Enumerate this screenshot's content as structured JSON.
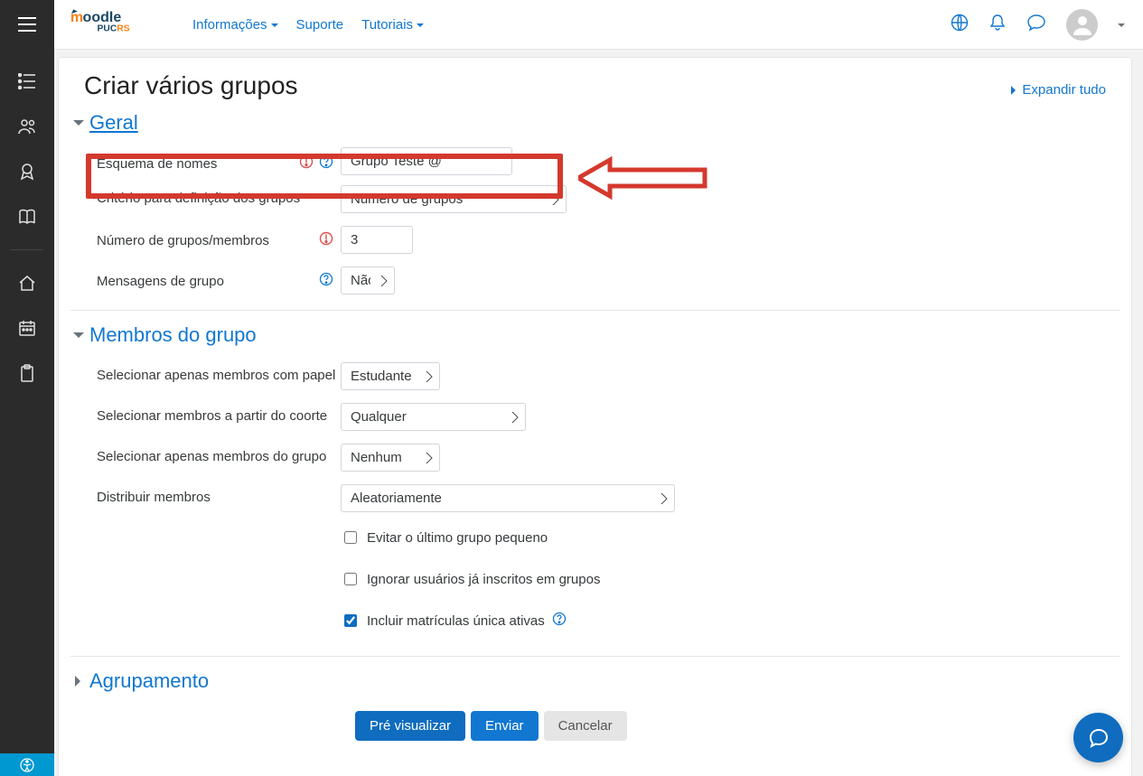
{
  "header": {
    "nav": [
      {
        "label": "Informações",
        "has_caret": true
      },
      {
        "label": "Suporte",
        "has_caret": false
      },
      {
        "label": "Tutoriais",
        "has_caret": true
      }
    ]
  },
  "page": {
    "title": "Criar vários grupos",
    "expand_all": "Expandir tudo"
  },
  "sections": {
    "geral": {
      "title": "Geral",
      "fields": {
        "naming_scheme": {
          "label": "Esquema de nomes",
          "value": "Grupo Teste @"
        },
        "criterion": {
          "label": "Critério para definição dos grupos",
          "value": "Número de grupos"
        },
        "count": {
          "label": "Número de grupos/membros",
          "value": "3"
        },
        "messages": {
          "label": "Mensagens de grupo",
          "value": "Não"
        }
      }
    },
    "membros": {
      "title": "Membros do grupo",
      "fields": {
        "role": {
          "label": "Selecionar apenas membros com papel",
          "value": "Estudante"
        },
        "cohort": {
          "label": "Selecionar membros a partir do coorte",
          "value": "Qualquer"
        },
        "from_group": {
          "label": "Selecionar apenas membros do grupo",
          "value": "Nenhum"
        },
        "distribute": {
          "label": "Distribuir membros",
          "value": "Aleatoriamente"
        },
        "avoid_small": "Evitar o último grupo pequeno",
        "ignore_enrolled": "Ignorar usuários já inscritos em grupos",
        "only_active": "Incluir matrículas única ativas"
      }
    },
    "agrupamento": {
      "title": "Agrupamento"
    }
  },
  "buttons": {
    "preview": "Pré visualizar",
    "submit": "Enviar",
    "cancel": "Cancelar"
  }
}
